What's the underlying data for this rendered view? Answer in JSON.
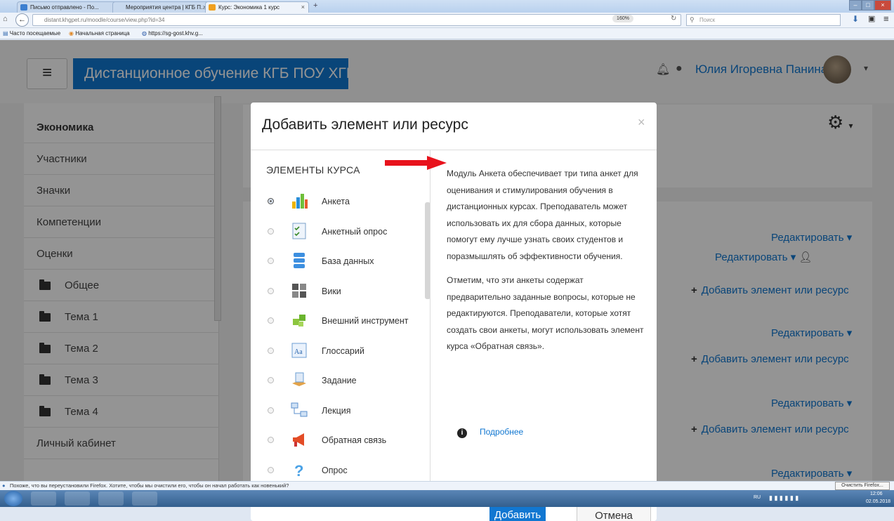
{
  "browser": {
    "tabs": [
      {
        "title": "Письмо отправлено - По...",
        "active": false
      },
      {
        "title": "Мероприятия центра | КГБ П...",
        "active": false
      },
      {
        "title": "Курс: Экономика 1 курс",
        "active": true
      }
    ],
    "new_tab": "+",
    "url": "distant.khgpet.ru/moodle/course/view.php?id=34",
    "zoom": "160%",
    "search_placeholder": "Поиск",
    "bookmarks": [
      "Часто посещаемые",
      "Начальная страница",
      "https://sg-gost.khv.g..."
    ]
  },
  "site": {
    "brand": "Дистанционное обучение КГБ ПОУ ХГПЭТ",
    "user_name": "Юлия Игоревна Панина"
  },
  "drawer": {
    "items": [
      {
        "label": "Экономика",
        "bold": true,
        "folder": false
      },
      {
        "label": "Участники",
        "bold": false,
        "folder": false
      },
      {
        "label": "Значки",
        "bold": false,
        "folder": false
      },
      {
        "label": "Компетенции",
        "bold": false,
        "folder": false
      },
      {
        "label": "Оценки",
        "bold": false,
        "folder": false
      },
      {
        "label": "Общее",
        "bold": false,
        "folder": true
      },
      {
        "label": "Тема 1",
        "bold": false,
        "folder": true
      },
      {
        "label": "Тема 2",
        "bold": false,
        "folder": true
      },
      {
        "label": "Тема 3",
        "bold": false,
        "folder": true
      },
      {
        "label": "Тема 4",
        "bold": false,
        "folder": true
      },
      {
        "label": "Личный кабинет",
        "bold": false,
        "folder": false
      }
    ]
  },
  "content": {
    "edit_label": "Редактировать",
    "add_label": "Добавить элемент или ресурс"
  },
  "modal": {
    "title": "Добавить элемент или ресурс",
    "close": "×",
    "section_header": "ЭЛЕМЕНТЫ КУРСА",
    "items": [
      {
        "label": "Анкета",
        "icon": "survey-chart-icon",
        "selected": true
      },
      {
        "label": "Анкетный опрос",
        "icon": "questionnaire-icon",
        "selected": false
      },
      {
        "label": "База данных",
        "icon": "database-icon",
        "selected": false
      },
      {
        "label": "Вики",
        "icon": "wiki-icon",
        "selected": false
      },
      {
        "label": "Внешний инструмент",
        "icon": "puzzle-icon",
        "selected": false
      },
      {
        "label": "Глоссарий",
        "icon": "glossary-icon",
        "selected": false
      },
      {
        "label": "Задание",
        "icon": "assignment-icon",
        "selected": false
      },
      {
        "label": "Лекция",
        "icon": "lesson-icon",
        "selected": false
      },
      {
        "label": "Обратная связь",
        "icon": "megaphone-icon",
        "selected": false
      },
      {
        "label": "Опрос",
        "icon": "question-mark-icon",
        "selected": false
      }
    ],
    "description_p1": "Модуль Анкета обеспечивает три типа анкет для оценивания и стимулирования обучения в дистанционных курсах. Преподаватель может использовать их для сбора данных, которые помогут ему лучше узнать своих студентов и поразмышлять об эффективности обучения.",
    "description_p2": "Отметим, что эти анкеты содержат предварительно заданные вопросы, которые не редактируются. Преподаватели, которые хотят создать свои анкеты, могут использовать элемент курса «Обратная связь».",
    "more_link": "Подробнее",
    "add_button": "Добавить",
    "cancel_button": "Отмена"
  },
  "notification": {
    "text": "Похоже, что вы переустановили Firefox. Хотите, чтобы мы очистили его, чтобы он начал работать как новенький?",
    "button": "Очистить Firefox..."
  },
  "taskbar": {
    "lang": "RU",
    "time": "12:06",
    "date": "02.05.2018"
  },
  "colors": {
    "accent": "#1177d1",
    "arrow": "#e8121c"
  }
}
